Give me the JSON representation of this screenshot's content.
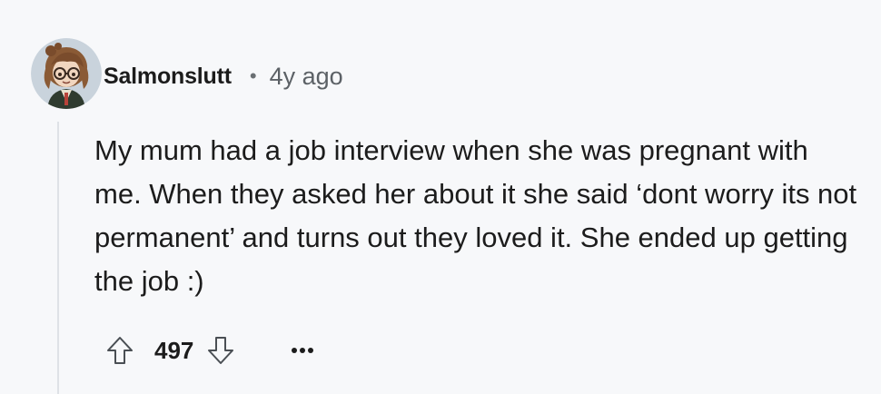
{
  "comment": {
    "author": "Salmonslutt",
    "separator": "•",
    "timestamp": "4y ago",
    "body": "My mum had a job interview when she was pregnant with me. When they asked her about it she said ‘dont worry its not permanent’ and turns out they loved it. She ended up getting the job :)",
    "score": "497"
  },
  "icons": {
    "avatar": "avatar-character",
    "upvote": "arrow-up-outline-icon",
    "downvote": "arrow-down-outline-icon",
    "more": "ellipsis-horizontal-icon"
  },
  "colors": {
    "background": "#f7f8fa",
    "text": "#1c1c1c",
    "muted": "#5c6166",
    "icon": "#4a4f54",
    "thread_line": "#dfe2e6"
  }
}
